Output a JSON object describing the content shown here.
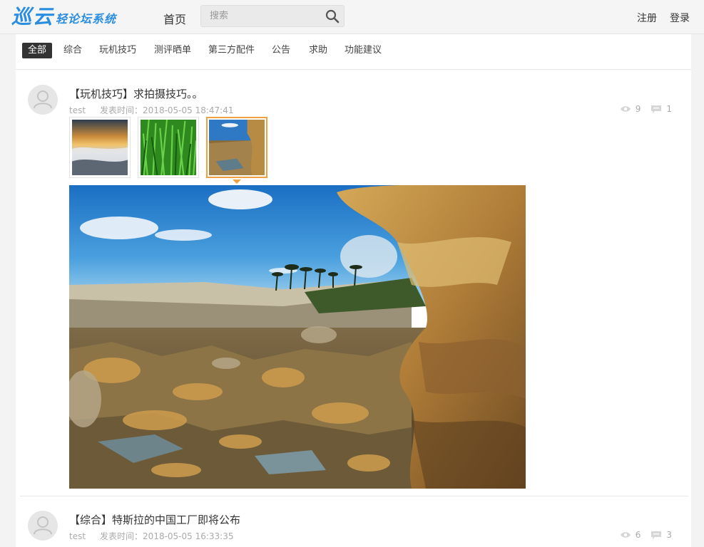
{
  "header": {
    "logo_big": "巡云",
    "logo_small": "轻论坛系统",
    "home_label": "首页",
    "search_placeholder": "搜索",
    "register_label": "注册",
    "login_label": "登录",
    "brand_color": "#2a8de0"
  },
  "tabs": [
    {
      "label": "全部",
      "active": true
    },
    {
      "label": "综合"
    },
    {
      "label": "玩机技巧"
    },
    {
      "label": "测评晒单"
    },
    {
      "label": "第三方配件"
    },
    {
      "label": "公告"
    },
    {
      "label": "求助"
    },
    {
      "label": "功能建议"
    }
  ],
  "posts": [
    {
      "title": "【玩机技巧】求拍摄技巧。。",
      "author": "test",
      "time": "发表时间：2018-05-05 18:47:41",
      "views": "9",
      "comments": "1",
      "thumbnails": [
        "misty-sunset-thumbnail",
        "green-grass-thumbnail",
        "rocky-coast-thumbnail"
      ],
      "selected_thumbnail": 2
    },
    {
      "title": "【综合】特斯拉的中国工厂即将公布",
      "author": "test",
      "time": "发表时间：2018-05-05 16:33:35",
      "views": "6",
      "comments": "3"
    }
  ],
  "icons": {
    "search": "search-icon",
    "views": "eye-icon",
    "comments": "comment-icon",
    "avatar": "user-avatar-icon"
  },
  "colors": {
    "active_tab_bg": "#333333",
    "thumb_selected_border": "#f0a040",
    "meta_text": "#aaaaaa"
  }
}
